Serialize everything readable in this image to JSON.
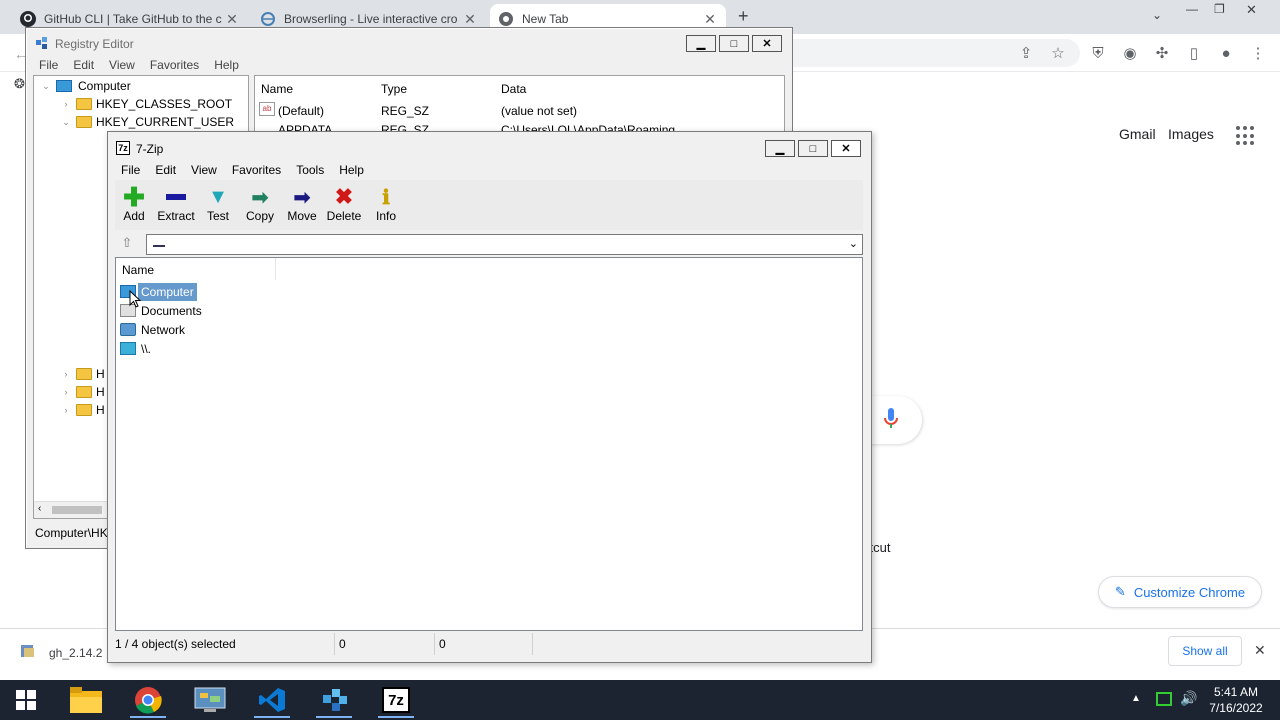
{
  "browser": {
    "tabs": [
      {
        "title": "GitHub CLI | Take GitHub to the c"
      },
      {
        "title": "Browserling - Live interactive cro"
      },
      {
        "title": "New Tab"
      }
    ],
    "new_tab_symbol": "+",
    "google_links": {
      "gmail": "Gmail",
      "images": "Images"
    },
    "shortcut_label_partial": "ortcut",
    "customize_label": "Customize Chrome",
    "download": {
      "filename": "gh_2.14.2",
      "show_all": "Show all"
    }
  },
  "registry": {
    "title": "Registry Editor",
    "menu": [
      "File",
      "Edit",
      "View",
      "Favorites",
      "Help"
    ],
    "tree": {
      "root": "Computer",
      "items": [
        "HKEY_CLASSES_ROOT",
        "HKEY_CURRENT_USER"
      ],
      "bottom_items": [
        "H",
        "H",
        "H"
      ]
    },
    "columns": {
      "name": "Name",
      "type": "Type",
      "data": "Data"
    },
    "rows": [
      {
        "name": "(Default)",
        "type": "REG_SZ",
        "data": "(value not set)"
      },
      {
        "name": "APPDATA",
        "type": "REG_SZ",
        "data": "C:\\Users\\LOL\\AppData\\Roaming"
      }
    ],
    "status": "Computer\\HK"
  },
  "zip": {
    "title": "7-Zip",
    "menu": [
      "File",
      "Edit",
      "View",
      "Favorites",
      "Tools",
      "Help"
    ],
    "toolbar": [
      {
        "label": "Add",
        "icon": "plus-icon",
        "color": "#22aa22"
      },
      {
        "label": "Extract",
        "icon": "minus-icon",
        "color": "#1a1aa0"
      },
      {
        "label": "Test",
        "icon": "check-icon",
        "color": "#20a8b8"
      },
      {
        "label": "Copy",
        "icon": "copy-arrow-icon",
        "color": "#208060"
      },
      {
        "label": "Move",
        "icon": "move-arrow-icon",
        "color": "#1a1a80"
      },
      {
        "label": "Delete",
        "icon": "delete-x-icon",
        "color": "#d01818"
      },
      {
        "label": "Info",
        "icon": "info-icon",
        "color": "#c8a000"
      }
    ],
    "address_value": "",
    "list_header": "Name",
    "items": [
      {
        "name": "Computer",
        "selected": true
      },
      {
        "name": "Documents",
        "selected": false
      },
      {
        "name": "Network",
        "selected": false
      },
      {
        "name": "\\\\.",
        "selected": false
      }
    ],
    "status": {
      "selection": "1 / 4 object(s) selected",
      "size1": "0",
      "size2": "0"
    }
  },
  "taskbar": {
    "time": "5:41 AM",
    "date": "7/16/2022",
    "apps": [
      "windows-start",
      "file-explorer",
      "chrome",
      "control-panel",
      "vscode",
      "registry-editor",
      "7zip"
    ],
    "zip_icon_label": "7z"
  },
  "colors": {
    "selection": "#6699cc",
    "taskbar": "#1c2431",
    "chrome_blue": "#1a73e8"
  }
}
